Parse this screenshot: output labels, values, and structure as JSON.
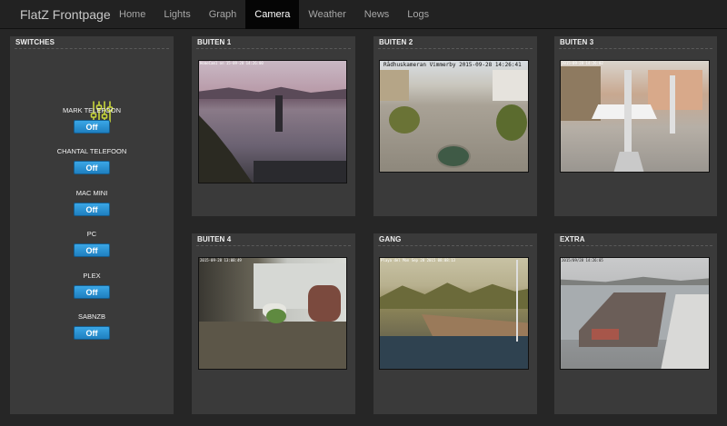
{
  "navbar": {
    "brand": "FlatZ Frontpage",
    "items": [
      {
        "label": "Home",
        "active": false
      },
      {
        "label": "Lights",
        "active": false
      },
      {
        "label": "Graph",
        "active": false
      },
      {
        "label": "Camera",
        "active": true
      },
      {
        "label": "Weather",
        "active": false
      },
      {
        "label": "News",
        "active": false
      },
      {
        "label": "Logs",
        "active": false
      }
    ]
  },
  "switches": {
    "title": "SWITCHES",
    "icon": "sliders-icon",
    "accent": "#c8d63a",
    "items": [
      {
        "label": "MARK TELEFOON",
        "state": "Off"
      },
      {
        "label": "CHANTAL TELEFOON",
        "state": "Off"
      },
      {
        "label": "MAC MINI",
        "state": "Off"
      },
      {
        "label": "PC",
        "state": "Off"
      },
      {
        "label": "PLEX",
        "state": "Off"
      },
      {
        "label": "SABNZB",
        "state": "Off"
      }
    ]
  },
  "cameras": [
    {
      "title": "BUITEN 1",
      "stamp": "HomeCam1 on 15-09-28 14:26:00"
    },
    {
      "title": "BUITEN 2",
      "stamp": "Rådhuskameran Vimmerby 2015-09-28 14:26:41"
    },
    {
      "title": "BUITEN 3",
      "stamp": "2015-09-28 14:26:02"
    },
    {
      "title": "BUITEN 4",
      "stamp": "2015-09-28 13:08:49"
    },
    {
      "title": "GANG",
      "stamp": "Playa del Mon Sep 28 2015 08:08:13"
    },
    {
      "title": "EXTRA",
      "stamp": "2015/09/28 14:26:05"
    }
  ],
  "colors": {
    "background": "#262626",
    "panel": "#3a3a3a",
    "navbar": "#222222",
    "nav_active": "#050505",
    "button": "#2a90d6"
  }
}
